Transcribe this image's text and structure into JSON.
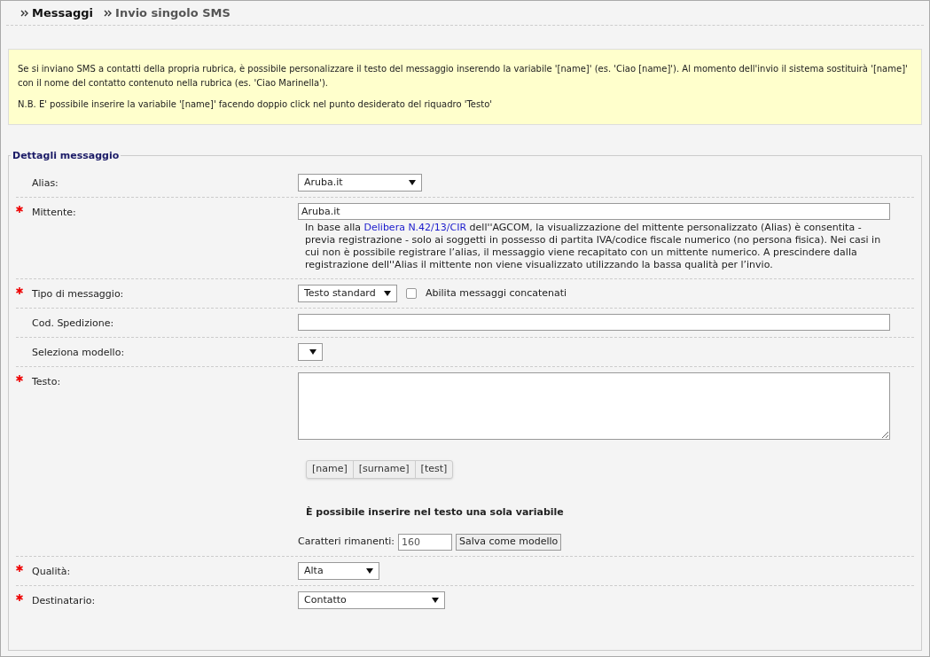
{
  "breadcrumb": [
    {
      "label": "Messaggi",
      "current": false
    },
    {
      "label": "Invio singolo SMS",
      "current": true
    }
  ],
  "info": {
    "paragraphs": [
      "Se si inviano SMS a contatti della propria rubrica, è possibile personalizzare il testo del messaggio inserendo la variabile '[name]' (es. 'Ciao [name]'). Al momento dell'invio il sistema sostituirà '[name]' con il nome del contatto contenuto nella rubrica (es. 'Ciao Marinella').",
      "N.B. E' possibile inserire la variabile '[name]' facendo doppio click nel punto desiderato del riquadro 'Testo'"
    ]
  },
  "form": {
    "legend": "Dettagli messaggio",
    "fields": [
      {
        "kind": "select",
        "label": "Alias:",
        "required": false,
        "value": "Aruba.it"
      },
      {
        "kind": "text",
        "label": "Mittente:",
        "required": true,
        "value": "Aruba.it",
        "note": {
          "before": "In base alla ",
          "link": "Delibera N.42/13/CIR",
          "after": " dell''AGCOM, la visualizzazione del mittente personalizzato (Alias) è consentita - previa registrazione - solo ai soggetti in possesso di partita IVA/codice fiscale numerico (no persona fisica). Nei casi in cui non è possibile registrare l’alias, il messaggio viene recapitato con un mittente numerico. A prescindere dalla registrazione dell''Alias il mittente non viene visualizzato utilizzando la bassa qualità per l’invio."
        }
      },
      {
        "kind": "select",
        "label": "Tipo di messaggio:",
        "required": true,
        "value": "Testo standard",
        "checkbox": {
          "label": "Abilita messaggi concatenati",
          "checked": false
        }
      },
      {
        "kind": "text",
        "label": "Cod. Spedizione:",
        "required": false
      },
      {
        "kind": "select",
        "label": "Seleziona modello:",
        "required": false
      },
      {
        "kind": "textarea",
        "label": "Testo:",
        "required": true,
        "variables": [
          "[name]",
          "[surname]",
          "[test]"
        ],
        "hint": "È possibile inserire nel testo una sola variabile",
        "counter_label": "Caratteri rimanenti:",
        "counter_value": "160",
        "save_button": "Salva come modello"
      },
      {
        "kind": "select",
        "label": "Qualità:",
        "required": true,
        "value": "Alta"
      },
      {
        "kind": "select",
        "label": "Destinatario:",
        "required": true,
        "value": "Contatto"
      }
    ]
  }
}
